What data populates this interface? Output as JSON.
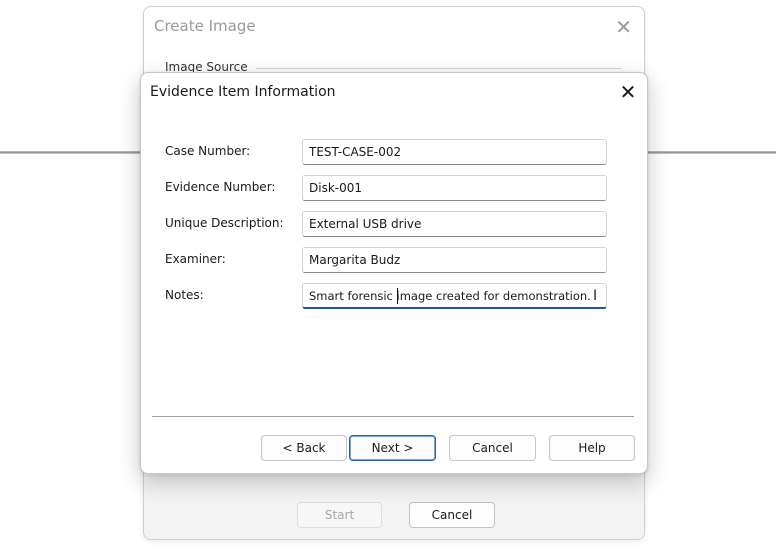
{
  "background_window": {
    "title": "Create Image",
    "group_label": "Image Source",
    "start_label": "Start",
    "cancel_label": "Cancel"
  },
  "dialog": {
    "title": "Evidence Item Information",
    "fields": [
      {
        "label": "Case Number:",
        "value": "TEST-CASE-002"
      },
      {
        "label": "Evidence Number:",
        "value": "Disk-001"
      },
      {
        "label": "Unique Description:",
        "value": "External USB drive"
      },
      {
        "label": "Examiner:",
        "value": "Margarita Budz"
      },
      {
        "label": "Notes:",
        "value": "Smart forensic image created for demonstration."
      }
    ],
    "buttons": {
      "back": "< Back",
      "next": "Next >",
      "cancel": "Cancel",
      "help": "Help"
    }
  },
  "icons": {
    "close": "close-icon",
    "text_cursor": "i-beam-cursor-icon"
  },
  "colors": {
    "focus_accent": "#1e57a8"
  }
}
